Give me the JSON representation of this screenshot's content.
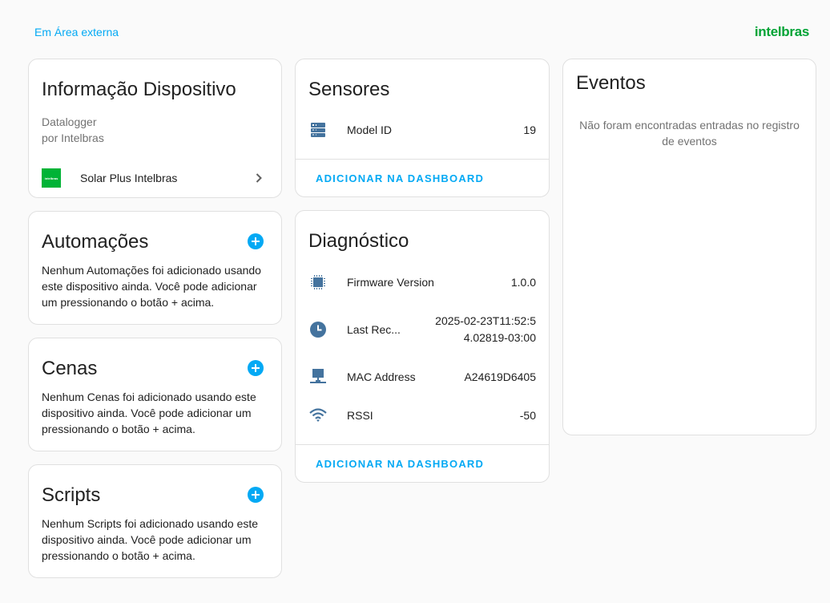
{
  "header": {
    "area_link": "Em Área externa",
    "brand": "intelbras"
  },
  "device_info": {
    "title": "Informação Dispositivo",
    "model": "Datalogger",
    "manufacturer": "por Intelbras",
    "integration_logo_text": "intelbras",
    "integration_label": "Solar Plus Intelbras",
    "chevron_icon": "chevron-right-icon"
  },
  "automations": {
    "title": "Automações",
    "text": "Nenhum Automações foi adicionado usando este dispositivo ainda. Você pode adicionar um pressionando o botão + acima."
  },
  "scenes": {
    "title": "Cenas",
    "text": "Nenhum Cenas foi adicionado usando este dispositivo ainda. Você pode adicionar um pressionando o botão + acima."
  },
  "scripts": {
    "title": "Scripts",
    "text": "Nenhum Scripts foi adicionado usando este dispositivo ainda. Você pode adicionar um pressionando o botão + acima."
  },
  "sensors": {
    "title": "Sensores",
    "rows": [
      {
        "icon": "server-icon",
        "name": "Model ID",
        "value": "19"
      }
    ],
    "action": "ADICIONAR NA DASHBOARD"
  },
  "diagnostics": {
    "title": "Diagnóstico",
    "rows": [
      {
        "icon": "chip-icon",
        "name": "Firmware Version",
        "value": "1.0.0"
      },
      {
        "icon": "clock-icon",
        "name": "Last Rec...",
        "value": "2025-02-23T11:52:54.02819-03:00"
      },
      {
        "icon": "network-icon",
        "name": "MAC Address",
        "value": "A24619D6405"
      },
      {
        "icon": "wifi-icon",
        "name": "RSSI",
        "value": "-50"
      }
    ],
    "action": "ADICIONAR NA DASHBOARD"
  },
  "events": {
    "title": "Eventos",
    "empty_text": "Não foram encontradas entradas no registro de eventos"
  },
  "colors": {
    "accent": "#03a9f4",
    "brand": "#00a335",
    "icon": "#44739e"
  }
}
